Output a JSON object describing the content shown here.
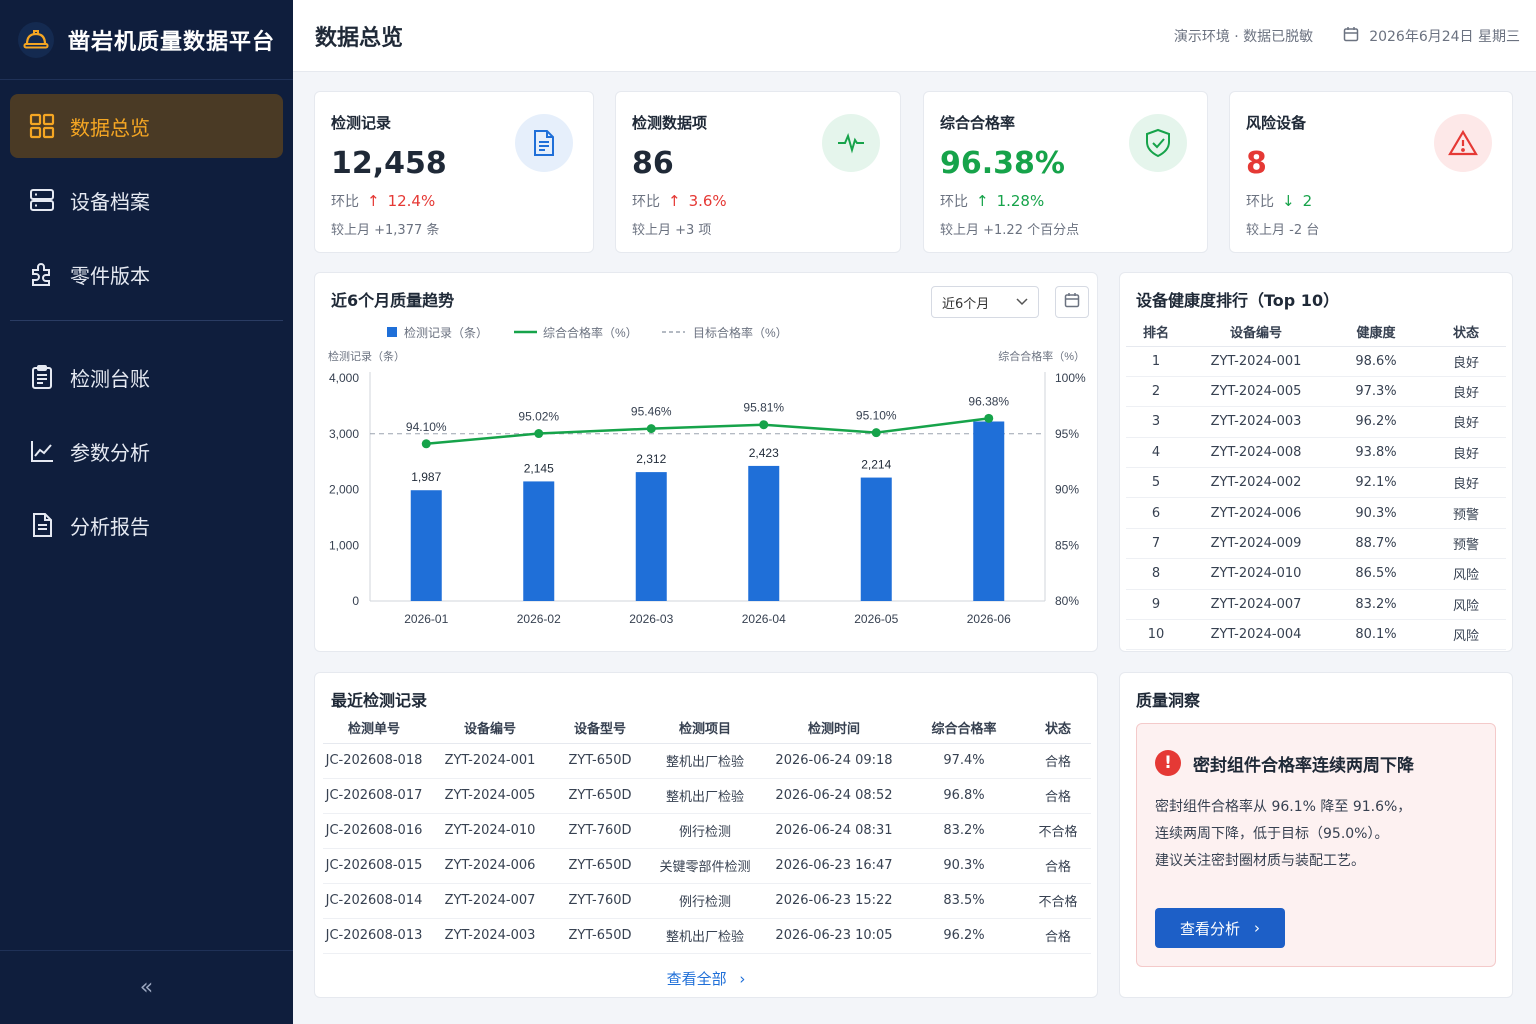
{
  "app": {
    "title": "凿岩机质量数据平台"
  },
  "sidebar": {
    "items": [
      {
        "label": "数据总览",
        "icon": "grid-icon",
        "active": true
      },
      {
        "label": "设备档案",
        "icon": "server-icon"
      },
      {
        "label": "零件版本",
        "icon": "puzzle-icon"
      },
      {
        "label": "检测台账",
        "icon": "clipboard-icon"
      },
      {
        "label": "参数分析",
        "icon": "line-chart-icon"
      },
      {
        "label": "分析报告",
        "icon": "document-icon"
      }
    ],
    "collapse": "«"
  },
  "header": {
    "title": "数据总览",
    "env": "演示环境 · 数据已脱敏",
    "date": "2026年6月24日 星期三"
  },
  "kpis": [
    {
      "title": "检测记录",
      "value": "12,458",
      "mom_label": "环比",
      "arrow": "↑",
      "mom": "12.4%",
      "detail": "较上月   +1,377  条",
      "value_color": "#1f2937",
      "trend_color": "#e53935",
      "icon": "document-icon"
    },
    {
      "title": "检测数据项",
      "value": "86",
      "mom_label": "环比",
      "arrow": "↑",
      "mom": "3.6%",
      "detail": "较上月   +3  项",
      "value_color": "#1f2937",
      "trend_color": "#e53935",
      "icon": "pulse-icon"
    },
    {
      "title": "综合合格率",
      "value": "96.38%",
      "mom_label": "环比",
      "arrow": "↑",
      "mom": "1.28%",
      "detail": "较上月   +1.22  个百分点",
      "value_color": "#16a34a",
      "trend_color": "#16a34a",
      "icon": "shield-check-icon"
    },
    {
      "title": "风险设备",
      "value": "8",
      "mom_label": "环比",
      "arrow": "↓",
      "mom": "2",
      "detail": "较上月   -2  台",
      "value_color": "#e53935",
      "trend_color": "#16a34a",
      "icon": "warning-icon"
    }
  ],
  "trend": {
    "title": "近6个月质量趋势",
    "range_select": "近6个月"
  },
  "chart_data": {
    "type": "bar",
    "categories": [
      "2026-01",
      "2026-02",
      "2026-03",
      "2026-04",
      "2026-05",
      "2026-06"
    ],
    "series": [
      {
        "name": "检测记录（条）",
        "type": "bar",
        "axis": "left",
        "values": [
          1987,
          2145,
          2312,
          2423,
          2214,
          3220
        ],
        "labels": [
          "1,987",
          "2,145",
          "2,312",
          "2,423",
          "2,214",
          ""
        ],
        "color": "#1f6fd8"
      },
      {
        "name": "综合合格率（%）",
        "type": "line",
        "axis": "right",
        "values": [
          94.1,
          95.02,
          95.46,
          95.81,
          95.1,
          96.38
        ],
        "labels": [
          "94.10%",
          "95.02%",
          "95.46%",
          "95.81%",
          "95.10%",
          "96.38%"
        ],
        "color": "#16a34a"
      },
      {
        "name": "目标合格率（%）",
        "type": "dashed-line",
        "axis": "right",
        "values": [
          95,
          95,
          95,
          95,
          95,
          95
        ],
        "color": "#9ca3af"
      }
    ],
    "ylabel_left": "检测记录（条）",
    "ylabel_right": "综合合格率（%）",
    "yticks_left": [
      "0",
      "1,000",
      "2,000",
      "3,000",
      "4,000"
    ],
    "yticks_right": [
      "80%",
      "85%",
      "90%",
      "95%",
      "100%"
    ],
    "ylim_left": [
      0,
      4000
    ],
    "ylim_right": [
      80,
      100
    ],
    "grid": false,
    "legend": "top-left"
  },
  "ranking": {
    "title": "设备健康度排行（Top 10）",
    "headers": [
      "排名",
      "设备编号",
      "健康度",
      "状态"
    ],
    "rows": [
      {
        "rank": "1",
        "id": "ZYT-2024-001",
        "health": "98.6%",
        "status": "良好",
        "level": "good"
      },
      {
        "rank": "2",
        "id": "ZYT-2024-005",
        "health": "97.3%",
        "status": "良好",
        "level": "good"
      },
      {
        "rank": "3",
        "id": "ZYT-2024-003",
        "health": "96.2%",
        "status": "良好",
        "level": "good"
      },
      {
        "rank": "4",
        "id": "ZYT-2024-008",
        "health": "93.8%",
        "status": "良好",
        "level": "good"
      },
      {
        "rank": "5",
        "id": "ZYT-2024-002",
        "health": "92.1%",
        "status": "良好",
        "level": "good"
      },
      {
        "rank": "6",
        "id": "ZYT-2024-006",
        "health": "90.3%",
        "status": "预警",
        "level": "warn"
      },
      {
        "rank": "7",
        "id": "ZYT-2024-009",
        "health": "88.7%",
        "status": "预警",
        "level": "warn"
      },
      {
        "rank": "8",
        "id": "ZYT-2024-010",
        "health": "86.5%",
        "status": "风险",
        "level": "risk"
      },
      {
        "rank": "9",
        "id": "ZYT-2024-007",
        "health": "83.2%",
        "status": "风险",
        "level": "risk"
      },
      {
        "rank": "10",
        "id": "ZYT-2024-004",
        "health": "80.1%",
        "status": "风险",
        "level": "risk"
      }
    ]
  },
  "records": {
    "title": "最近检测记录",
    "headers": [
      "检测单号",
      "设备编号",
      "设备型号",
      "检测项目",
      "检测时间",
      "综合合格率",
      "状态"
    ],
    "rows": [
      [
        "JC-202608-018",
        "ZYT-2024-001",
        "ZYT-650D",
        "整机出厂检验",
        "2026-06-24 09:18",
        "97.4%",
        "合格"
      ],
      [
        "JC-202608-017",
        "ZYT-2024-005",
        "ZYT-650D",
        "整机出厂检验",
        "2026-06-24 08:52",
        "96.8%",
        "合格"
      ],
      [
        "JC-202608-016",
        "ZYT-2024-010",
        "ZYT-760D",
        "例行检测",
        "2026-06-24 08:31",
        "83.2%",
        "不合格"
      ],
      [
        "JC-202608-015",
        "ZYT-2024-006",
        "ZYT-650D",
        "关键零部件检测",
        "2026-06-23 16:47",
        "90.3%",
        "合格"
      ],
      [
        "JC-202608-014",
        "ZYT-2024-007",
        "ZYT-760D",
        "例行检测",
        "2026-06-23 15:22",
        "83.5%",
        "不合格"
      ],
      [
        "JC-202608-013",
        "ZYT-2024-003",
        "ZYT-650D",
        "整机出厂检验",
        "2026-06-23 10:05",
        "96.2%",
        "合格"
      ]
    ],
    "view_all": "查看全部"
  },
  "insight": {
    "title": "质量洞察",
    "headline": "密封组件合格率连续两周下降",
    "lines": [
      "密封组件合格率从 96.1% 降至 91.6%，",
      "连续两周下降，低于目标（95.0%）。",
      "建议关注密封圈材质与装配工艺。"
    ],
    "button": "查看分析"
  }
}
